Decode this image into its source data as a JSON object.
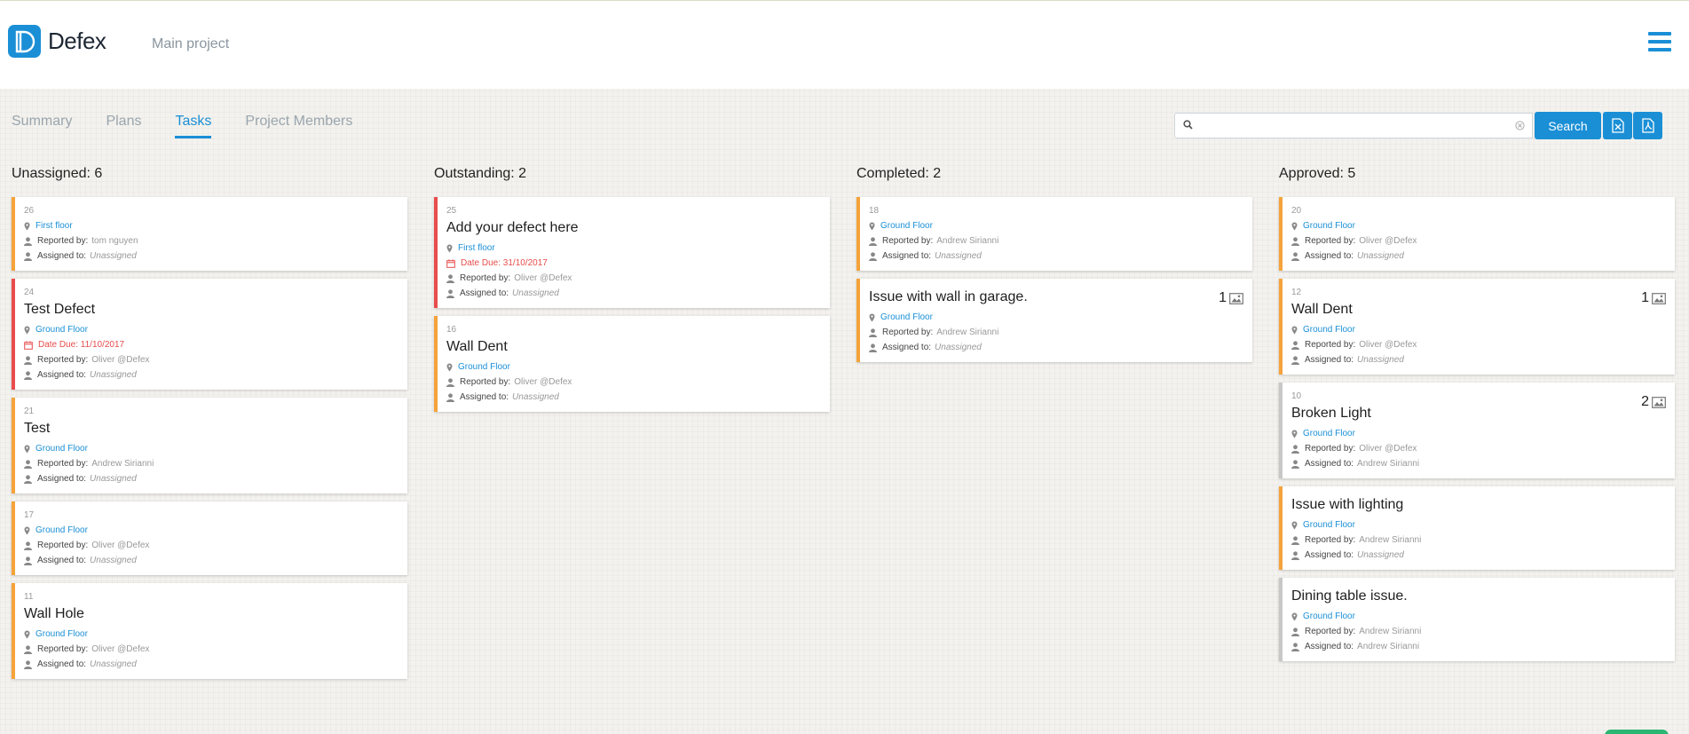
{
  "app": {
    "name": "Defex",
    "project": "Main project"
  },
  "tabs": [
    {
      "label": "Summary",
      "active": false
    },
    {
      "label": "Plans",
      "active": false
    },
    {
      "label": "Tasks",
      "active": true
    },
    {
      "label": "Project Members",
      "active": false
    }
  ],
  "search": {
    "placeholder": "",
    "value": "",
    "button_label": "Search"
  },
  "toolbar": {
    "export_excel_icon": "excel-file-icon",
    "export_pdf_icon": "pdf-file-icon"
  },
  "labels": {
    "reported_by": "Reported by:",
    "assigned_to": "Assigned to:",
    "date_due": "Date Due:"
  },
  "colors": {
    "accent": "#1a8fd6",
    "orange": "#f5a33a",
    "red": "#e84c4c",
    "gray": "#c7c7c7"
  },
  "columns": [
    {
      "title": "Unassigned: 6",
      "cards": [
        {
          "num": "26",
          "title": "",
          "location": "First floor",
          "due": "",
          "reported_by": "tom nguyen",
          "assigned_to": "Unassigned",
          "photos": "",
          "status": "orange"
        },
        {
          "num": "24",
          "title": "Test Defect",
          "location": "Ground Floor",
          "due": "Date Due: 11/10/2017",
          "reported_by": "Oliver @Defex",
          "assigned_to": "Unassigned",
          "photos": "",
          "status": "red"
        },
        {
          "num": "21",
          "title": "Test",
          "location": "Ground Floor",
          "due": "",
          "reported_by": "Andrew Sirianni",
          "assigned_to": "Unassigned",
          "photos": "",
          "status": "orange"
        },
        {
          "num": "17",
          "title": "",
          "location": "Ground Floor",
          "due": "",
          "reported_by": "Oliver @Defex",
          "assigned_to": "Unassigned",
          "photos": "",
          "status": "orange"
        },
        {
          "num": "11",
          "title": "Wall Hole",
          "location": "Ground Floor",
          "due": "",
          "reported_by": "Oliver @Defex",
          "assigned_to": "Unassigned",
          "photos": "",
          "status": "orange"
        }
      ]
    },
    {
      "title": "Outstanding: 2",
      "cards": [
        {
          "num": "25",
          "title": "Add your defect here",
          "location": "First floor",
          "due": "Date Due: 31/10/2017",
          "reported_by": "Oliver @Defex",
          "assigned_to": "Unassigned",
          "photos": "",
          "status": "red"
        },
        {
          "num": "16",
          "title": "Wall Dent",
          "location": "Ground Floor",
          "due": "",
          "reported_by": "Oliver @Defex",
          "assigned_to": "Unassigned",
          "photos": "",
          "status": "orange"
        }
      ]
    },
    {
      "title": "Completed: 2",
      "cards": [
        {
          "num": "18",
          "title": "",
          "location": "Ground Floor",
          "due": "",
          "reported_by": "Andrew Sirianni",
          "assigned_to": "Unassigned",
          "photos": "",
          "status": "orange"
        },
        {
          "num": "",
          "title": "Issue with wall in garage.",
          "location": "Ground Floor",
          "due": "",
          "reported_by": "Andrew Sirianni",
          "assigned_to": "Unassigned",
          "photos": "1",
          "status": "orange"
        }
      ]
    },
    {
      "title": "Approved: 5",
      "cards": [
        {
          "num": "20",
          "title": "",
          "location": "Ground Floor",
          "due": "",
          "reported_by": "Oliver @Defex",
          "assigned_to": "Unassigned",
          "photos": "",
          "status": "orange"
        },
        {
          "num": "12",
          "title": "Wall Dent",
          "location": "Ground Floor",
          "due": "",
          "reported_by": "Oliver @Defex",
          "assigned_to": "Unassigned",
          "photos": "1",
          "status": "orange"
        },
        {
          "num": "10",
          "title": "Broken Light",
          "location": "Ground Floor",
          "due": "",
          "reported_by": "Oliver @Defex",
          "assigned_to": "Andrew Sirianni",
          "photos": "2",
          "status": "gray"
        },
        {
          "num": "",
          "title": "Issue with lighting",
          "location": "Ground Floor",
          "due": "",
          "reported_by": "Andrew Sirianni",
          "assigned_to": "Unassigned",
          "photos": "",
          "status": "orange"
        },
        {
          "num": "",
          "title": "Dining table issue.",
          "location": "Ground Floor",
          "due": "",
          "reported_by": "Andrew Sirianni",
          "assigned_to": "Andrew Sirianni",
          "photos": "",
          "status": "gray"
        }
      ]
    }
  ]
}
